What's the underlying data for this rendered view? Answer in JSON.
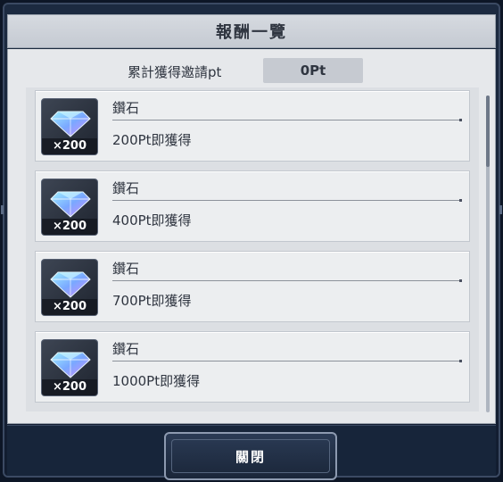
{
  "dialog": {
    "title": "報酬一覽"
  },
  "points": {
    "label": "累計獲得邀請pt",
    "value": "0Pt"
  },
  "rewards": [
    {
      "name": "鑽石",
      "quantity": "×200",
      "condition": "200Pt即獲得",
      "icon": "diamond-icon"
    },
    {
      "name": "鑽石",
      "quantity": "×200",
      "condition": "400Pt即獲得",
      "icon": "diamond-icon"
    },
    {
      "name": "鑽石",
      "quantity": "×200",
      "condition": "700Pt即獲得",
      "icon": "diamond-icon"
    },
    {
      "name": "鑽石",
      "quantity": "×200",
      "condition": "1000Pt即獲得",
      "icon": "diamond-icon"
    }
  ],
  "footer": {
    "close_label": "關閉"
  },
  "colors": {
    "frame": "#1c2a40",
    "panel": "#e6e8eb",
    "text": "#2f3540",
    "button": "#2b3b55"
  }
}
